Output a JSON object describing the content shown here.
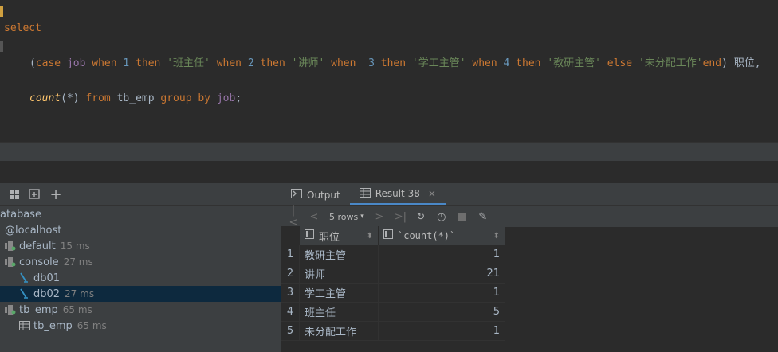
{
  "editor": {
    "line1": {
      "kw": "select"
    },
    "line2": {
      "t1": "(",
      "case": "case",
      "job1": "job",
      "when1": "when",
      "n1": "1",
      "then1": "then",
      "s1": "'班主任'",
      "when2": "when",
      "n2": "2",
      "then2": "then",
      "s2": "'讲师'",
      "when3": "when",
      "n3": "3",
      "then3": "then",
      "s3": "'学工主管'",
      "when4": "when",
      "n4": "4",
      "then4": "then",
      "s4": "'教研主管'",
      "else": "else",
      "s5": "'未分配工作'",
      "end": "end",
      "t2": ")",
      "alias": "职位,"
    },
    "line3": {
      "fn": "count",
      "args": "(*)",
      "from": "from",
      "table": "tb_emp",
      "group": "group",
      "by": "by",
      "job": "job",
      "semi": ";"
    }
  },
  "services": {
    "toolbar_icons": [
      "layout-icon",
      "add-service-icon",
      "add-icon"
    ],
    "add_label": "+",
    "tree": [
      {
        "label": "atabase",
        "time": ""
      },
      {
        "label": "@localhost",
        "time": ""
      },
      {
        "label": "default",
        "time": "15 ms"
      },
      {
        "label": "console",
        "time": "27 ms"
      },
      {
        "label": "db01",
        "time": ""
      },
      {
        "label": "db02",
        "time": "27 ms"
      },
      {
        "label": "tb_emp",
        "time": "65 ms"
      },
      {
        "label": "tb_emp",
        "time": "65 ms"
      }
    ]
  },
  "results": {
    "tabs": [
      {
        "label": "Output"
      },
      {
        "label": "Result 38"
      }
    ],
    "close_glyph": "×",
    "rows_label": "5 rows",
    "columns": [
      "职位",
      "`count(*)`"
    ],
    "rows": [
      {
        "n": "1",
        "pos": "教研主管",
        "count": "1"
      },
      {
        "n": "2",
        "pos": "讲师",
        "count": "21"
      },
      {
        "n": "3",
        "pos": "学工主管",
        "count": "1"
      },
      {
        "n": "4",
        "pos": "班主任",
        "count": "5"
      },
      {
        "n": "5",
        "pos": "未分配工作",
        "count": "1"
      }
    ]
  }
}
